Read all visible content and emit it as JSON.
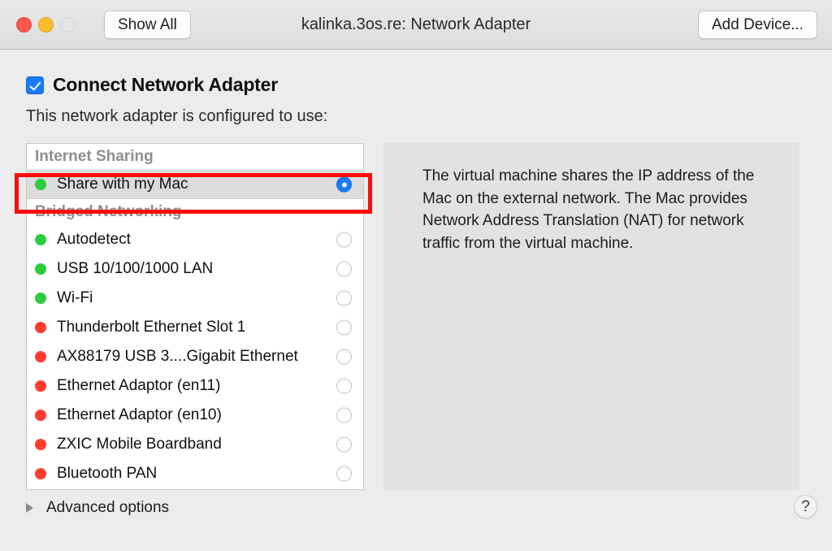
{
  "window": {
    "title": "kalinka.3os.re: Network Adapter",
    "show_all_label": "Show All",
    "add_device_label": "Add Device...",
    "traffic_lights": [
      "close-button",
      "minimize-button",
      "zoom-button"
    ]
  },
  "main": {
    "connect_checkbox_label": "Connect Network Adapter",
    "connect_checkbox_checked": true,
    "subtitle": "This network adapter is configured to use:",
    "groups": [
      {
        "header": "Internet Sharing",
        "items": [
          {
            "label": "Share with my Mac",
            "status": "green",
            "selected": true
          }
        ]
      },
      {
        "header": "Bridged Networking",
        "items": [
          {
            "label": "Autodetect",
            "status": "green",
            "selected": false
          },
          {
            "label": "USB 10/100/1000 LAN",
            "status": "green",
            "selected": false
          },
          {
            "label": "Wi-Fi",
            "status": "green",
            "selected": false
          },
          {
            "label": "Thunderbolt Ethernet Slot  1",
            "status": "red",
            "selected": false
          },
          {
            "label": "AX88179 USB 3....Gigabit Ethernet",
            "status": "red",
            "selected": false
          },
          {
            "label": "Ethernet Adaptor (en11)",
            "status": "red",
            "selected": false
          },
          {
            "label": "Ethernet Adaptor (en10)",
            "status": "red",
            "selected": false
          },
          {
            "label": "ZXIC Mobile Boardband",
            "status": "red",
            "selected": false
          },
          {
            "label": "Bluetooth PAN",
            "status": "red",
            "selected": false
          }
        ]
      }
    ],
    "description": "The virtual machine shares the IP address of the Mac on the external network. The Mac provides Network Address Translation (NAT) for network traffic from the virtual machine."
  },
  "footer": {
    "advanced_label": "Advanced options",
    "help_label": "?"
  },
  "colors": {
    "status_green": "#2dcc3e",
    "status_red": "#ff3b30",
    "accent_blue": "#1a7cf5",
    "annotation_red": "#fb0d0d",
    "window_bg": "#ececec",
    "panel_bg": "#e2e2e2"
  }
}
